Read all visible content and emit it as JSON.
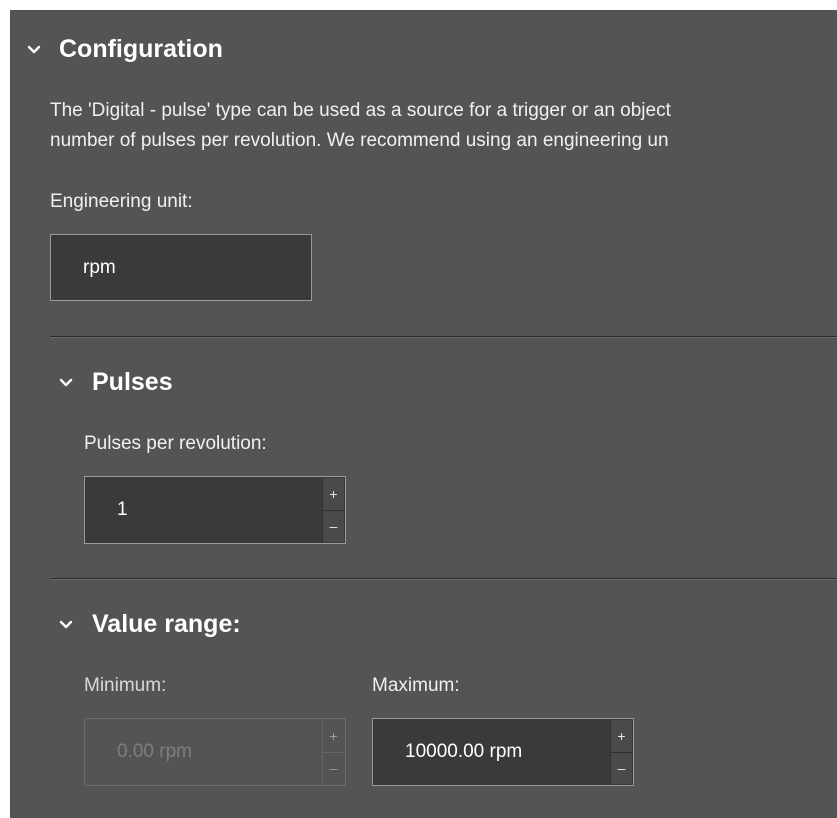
{
  "configuration": {
    "title": "Configuration",
    "description_line1": "The 'Digital - pulse' type can be used as a source for a trigger or an object",
    "description_line2": "number of pulses per revolution. We recommend using an engineering un",
    "engineering_unit_label": "Engineering unit:",
    "engineering_unit_value": "rpm"
  },
  "pulses": {
    "title": "Pulses",
    "ppr_label": "Pulses per revolution:",
    "ppr_value": "1"
  },
  "value_range": {
    "title": "Value range:",
    "minimum_label": "Minimum:",
    "minimum_value": "0.00 rpm",
    "minimum_enabled": false,
    "maximum_label": "Maximum:",
    "maximum_value": "10000.00 rpm",
    "maximum_enabled": true
  },
  "spinner": {
    "increment_glyph": "+",
    "decrement_glyph": "–"
  },
  "icons": {
    "expand": "chevron-down-icon"
  },
  "colors": {
    "panel_background": "#545454",
    "field_background": "#3a3a3a",
    "text": "#f0f0f0",
    "disabled_text": "#7e7e7e"
  }
}
